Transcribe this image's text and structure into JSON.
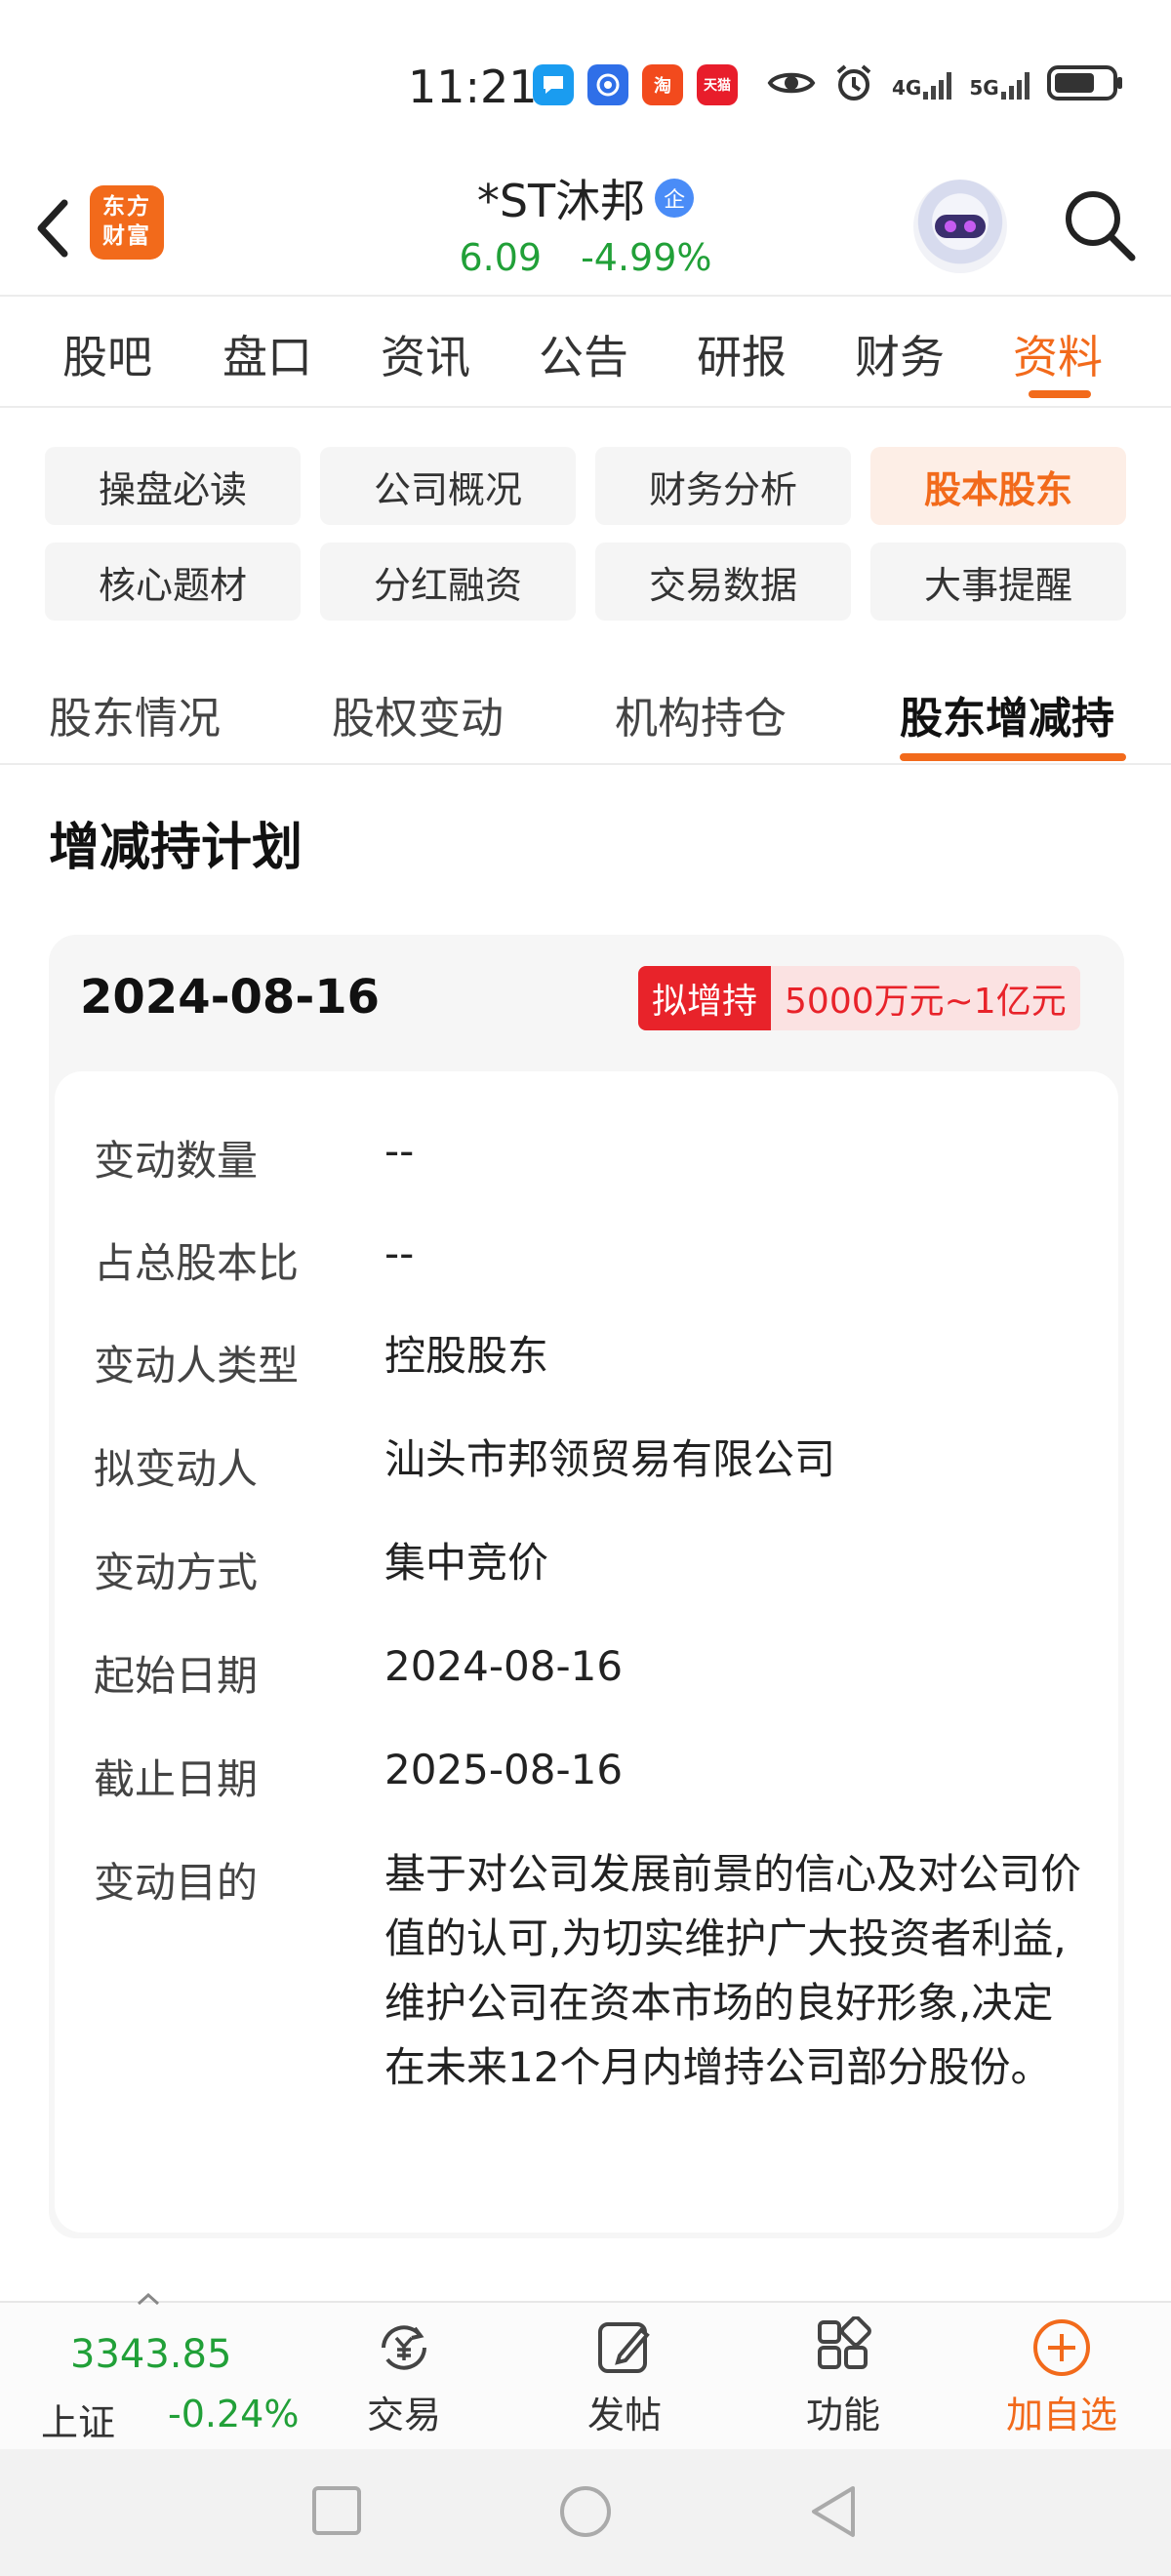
{
  "status_bar": {
    "time": "11:21",
    "apps": [
      {
        "name": "chat-app",
        "color": "#1a9cf0",
        "glyph": "💬"
      },
      {
        "name": "browser-app",
        "color": "#2f6fe8",
        "glyph": "◉"
      },
      {
        "name": "taobao-app",
        "color": "#f24a1d",
        "glyph": "淘"
      },
      {
        "name": "tmall-app",
        "color": "#e81d2b",
        "glyph": "天猫"
      }
    ],
    "network_1": "4G",
    "network_2": "5G"
  },
  "header": {
    "logo_line1": "东方",
    "logo_line2": "财富",
    "stock_name": "*ST沐邦",
    "verified_badge": "企",
    "price": "6.09",
    "change": "-4.99%"
  },
  "main_tabs": [
    "股吧",
    "盘口",
    "资讯",
    "公告",
    "研报",
    "财务",
    "资料"
  ],
  "main_tab_active": "资料",
  "sections": [
    "操盘必读",
    "公司概况",
    "财务分析",
    "股本股东",
    "核心题材",
    "分红融资",
    "交易数据",
    "大事提醒"
  ],
  "section_active": "股本股东",
  "sub_tabs": [
    "股东情况",
    "股权变动",
    "机构持仓",
    "股东增减持"
  ],
  "sub_tab_active": "股东增减持",
  "section_title": "增减持计划",
  "plan": {
    "date": "2024-08-16",
    "type": "拟增持",
    "amount": "5000万元~1亿元",
    "rows": [
      {
        "label": "变动数量",
        "value": "--"
      },
      {
        "label": "占总股本比",
        "value": "--"
      },
      {
        "label": "变动人类型",
        "value": "控股股东"
      },
      {
        "label": "拟变动人",
        "value": "汕头市邦领贸易有限公司"
      },
      {
        "label": "变动方式",
        "value": "集中竞价"
      },
      {
        "label": "起始日期",
        "value": "2024-08-16"
      },
      {
        "label": "截止日期",
        "value": "2025-08-16"
      },
      {
        "label": "变动目的",
        "value": "基于对公司发展前景的信心及对公司价值的认可,为切实维护广大投资者利益,维护公司在资本市场的良好形象,决定在未来12个月内增持公司部分股份。"
      }
    ]
  },
  "bottom_bar": {
    "index_value": "3343.85",
    "index_name": "上证",
    "index_change": "-0.24%",
    "items": [
      "交易",
      "发帖",
      "功能",
      "加自选"
    ]
  },
  "colors": {
    "accent": "#f26a1b",
    "down_green": "#21a038",
    "badge_red": "#e8232a"
  }
}
